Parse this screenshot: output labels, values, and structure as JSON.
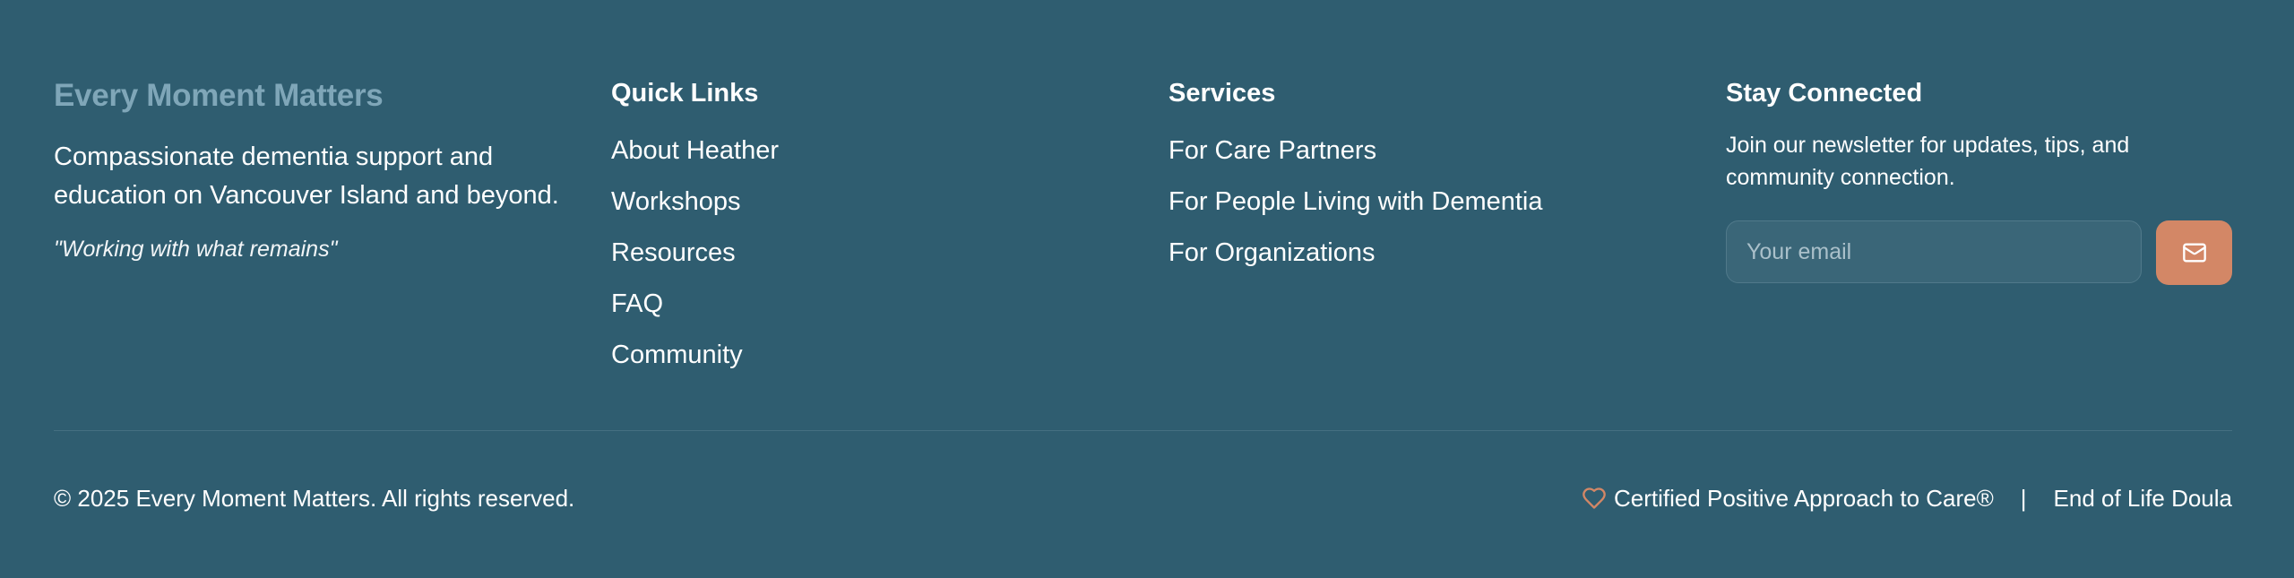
{
  "brand": {
    "name": "Every Moment Matters",
    "tagline": "Compassionate dementia support and education on Vancouver Island and beyond.",
    "motto": "\"Working with what remains\""
  },
  "quick_links": {
    "title": "Quick Links",
    "items": [
      "About Heather",
      "Workshops",
      "Resources",
      "FAQ",
      "Community"
    ]
  },
  "services": {
    "title": "Services",
    "items": [
      "For Care Partners",
      "For People Living with Dementia",
      "For Organizations"
    ]
  },
  "newsletter": {
    "title": "Stay Connected",
    "text": "Join our newsletter for updates, tips, and community connection.",
    "placeholder": "Your email",
    "submit_icon": "mail-icon"
  },
  "bottom": {
    "copyright": "© 2025 Every Moment Matters. All rights reserved.",
    "certification_icon": "heart-icon",
    "certification": "Certified Positive Approach to Care®",
    "separator": "|",
    "role": "End of Life Doula"
  },
  "colors": {
    "background": "#2f5d70",
    "brand_text": "#7fa6b8",
    "accent": "#d38766"
  }
}
